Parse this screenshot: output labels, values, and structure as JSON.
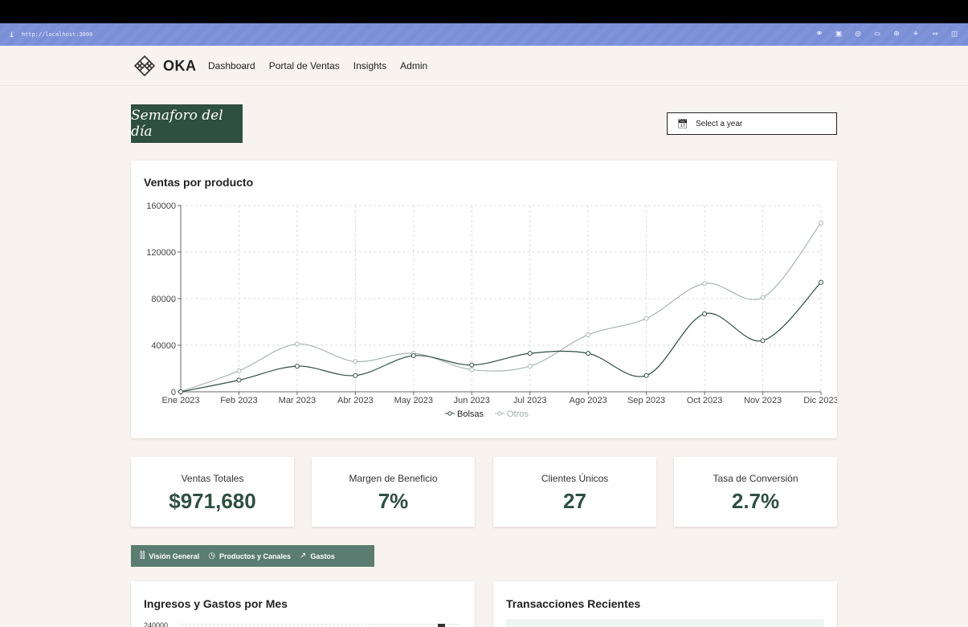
{
  "browser": {
    "info": "i",
    "url": "http://localhost:3000"
  },
  "nav": {
    "brand": "OKA",
    "items": [
      "Dashboard",
      "Portal de Ventas",
      "Insights",
      "Admin"
    ]
  },
  "header": {
    "banner": "Semaforo del día",
    "year_select_placeholder": "Select a year"
  },
  "chart_card": {
    "title": "Ventas por producto"
  },
  "chart_data": {
    "type": "line",
    "title": "Ventas por producto",
    "categories": [
      "Ene 2023",
      "Feb 2023",
      "Mar 2023",
      "Abr 2023",
      "May 2023",
      "Jun 2023",
      "Jul 2023",
      "Ago 2023",
      "Sep 2023",
      "Oct 2023",
      "Nov 2023",
      "Dic 2023"
    ],
    "series": [
      {
        "name": "Bolsas",
        "color": "#2f4f40",
        "values": [
          0,
          10000,
          22000,
          14000,
          31000,
          23000,
          33000,
          33000,
          14000,
          67000,
          44000,
          94000
        ]
      },
      {
        "name": "Otros",
        "color": "#a9b7b0",
        "values": [
          0,
          18000,
          41000,
          26000,
          33000,
          19000,
          22000,
          49000,
          63000,
          93000,
          81000,
          145000
        ]
      }
    ],
    "yticks": [
      0,
      40000,
      80000,
      120000,
      160000
    ],
    "ylim": [
      0,
      160000
    ],
    "grid": true,
    "legend": "bottom"
  },
  "kpis": [
    {
      "label": "Ventas Totales",
      "value": "$971,680"
    },
    {
      "label": "Margen de Beneficio",
      "value": "7%"
    },
    {
      "label": "Clientes Únicos",
      "value": "27"
    },
    {
      "label": "Tasa de Conversión",
      "value": "2.7%"
    }
  ],
  "tabs": [
    {
      "icon": "bar-chart-icon",
      "label": "Visión General"
    },
    {
      "icon": "clock-icon",
      "label": "Productos y Canales"
    },
    {
      "icon": "trending-icon",
      "label": "Gastos"
    }
  ],
  "bottom": {
    "left_title": "Ingresos y Gastos por Mes",
    "left_first_tick": "240000",
    "right_title": "Transacciones Recientes"
  }
}
